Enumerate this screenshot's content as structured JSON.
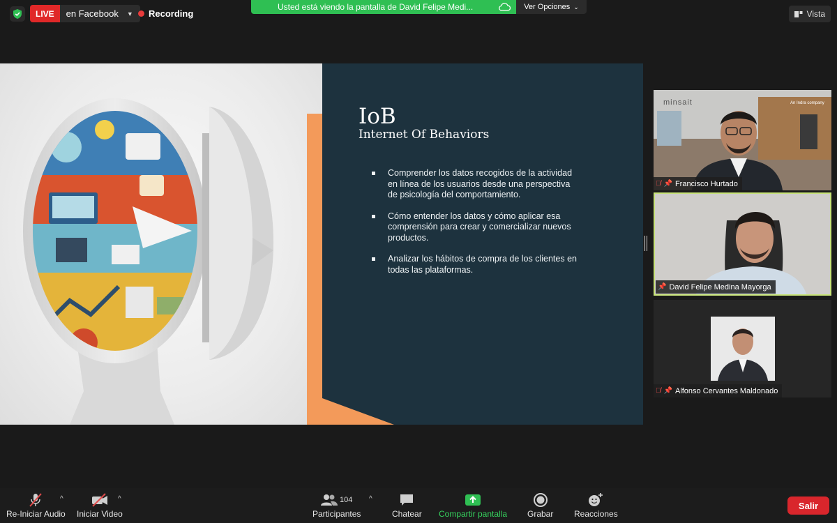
{
  "topbar": {
    "live_badge": "LIVE",
    "live_destination": "en Facebook",
    "recording": "Recording",
    "share_banner": "Usted está viendo la pantalla de David Felipe Medi...",
    "view_options": "Ver Opciones",
    "view_button": "Vista"
  },
  "slide": {
    "title": "IoB",
    "subtitle": "Internet Of Behaviors",
    "bullets": [
      "Comprender los datos recogidos de la actividad en línea de los usuarios desde una perspectiva de psicología del comportamiento.",
      "Cómo entender los datos y cómo aplicar esa comprensión para crear y comercializar nuevos productos.",
      "Analizar los hábitos de compra de los clientes en todas las plataformas."
    ],
    "accent_color": "#f39a5a",
    "panel_color": "#1d323e"
  },
  "participants": [
    {
      "name": "Francisco Hurtado",
      "muted": true,
      "pinned": true,
      "bg_text": "minsait",
      "bg_text2": "An Indra company"
    },
    {
      "name": "David Felipe Medina Mayorga",
      "muted": false,
      "pinned": true,
      "active_speaker": true
    },
    {
      "name": "Alfonso Cervantes Maldonado",
      "muted": true,
      "pinned": true
    }
  ],
  "toolbar": {
    "audio": "Re-Iniciar Audio",
    "video": "Iniciar Video",
    "participants": "Participantes",
    "participants_count": "104",
    "chat": "Chatear",
    "share": "Compartir pantalla",
    "record": "Grabar",
    "reactions": "Reacciones",
    "leave": "Salir"
  },
  "colors": {
    "live": "#e02828",
    "recording_dot": "#e83b3b",
    "share_banner": "#2fbf53",
    "active_speaker_border": "#c8e37a",
    "leave": "#d9262c"
  }
}
